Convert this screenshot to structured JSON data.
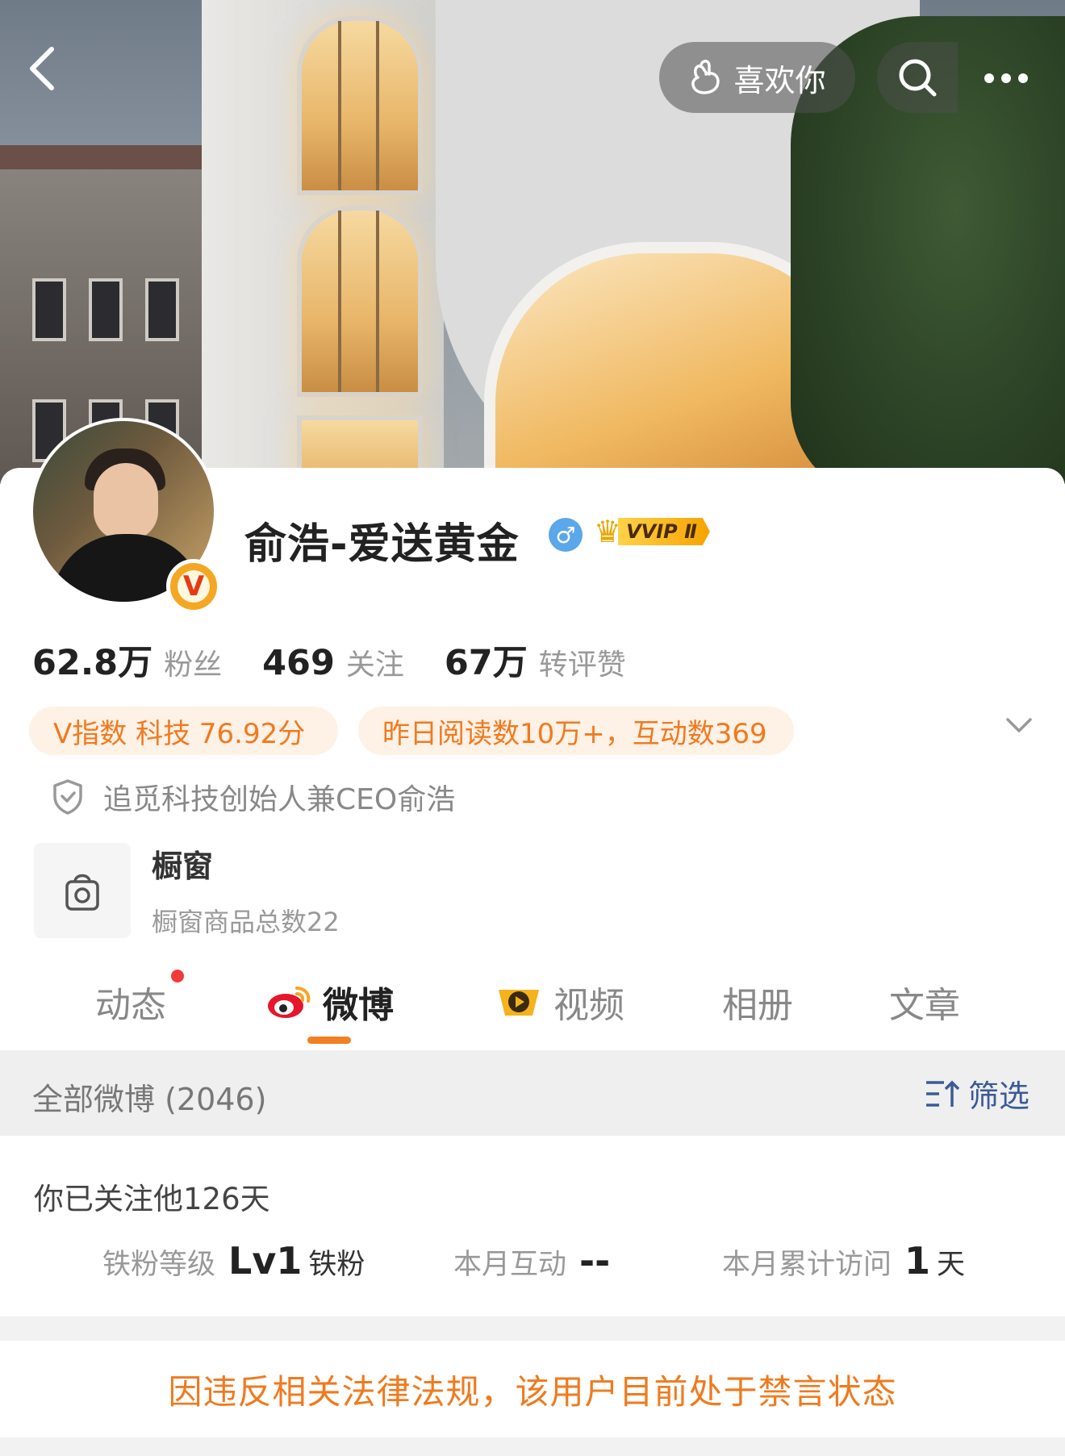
{
  "header": {
    "like_label": "喜欢你"
  },
  "profile": {
    "name": "俞浩-爱送黄金",
    "vip_label": "VVIP Ⅱ",
    "verified_badge": "V"
  },
  "stats": [
    {
      "value": "62.8万",
      "label": "粉丝"
    },
    {
      "value": "469",
      "label": "关注"
    },
    {
      "value": "67万",
      "label": "转评赞"
    }
  ],
  "chips": {
    "v_index": "V指数 科技 76.92分",
    "reads": "昨日阅读数10万+，互动数369"
  },
  "verification": "追觅科技创始人兼CEO俞浩",
  "shop": {
    "title": "橱窗",
    "subtitle": "橱窗商品总数22"
  },
  "tabs": [
    {
      "label": "动态"
    },
    {
      "label": "微博"
    },
    {
      "label": "视频"
    },
    {
      "label": "相册"
    },
    {
      "label": "文章"
    }
  ],
  "list": {
    "all_label": "全部微博 (2046)",
    "filter_label": "筛选"
  },
  "fan": {
    "follow_text": "你已关注他126天",
    "level_key": "铁粉等级",
    "level_value": "Lv1",
    "level_unit": "铁粉",
    "interact_key": "本月互动",
    "interact_value": "--",
    "visit_key": "本月累计访问",
    "visit_value": "1",
    "visit_unit": "天"
  },
  "ban_notice": "因违反相关法律法规，该用户目前处于禁言状态",
  "colors": {
    "accent": "#f07a1e",
    "chip_bg": "#fef1e6",
    "filter": "#3d5a96"
  }
}
